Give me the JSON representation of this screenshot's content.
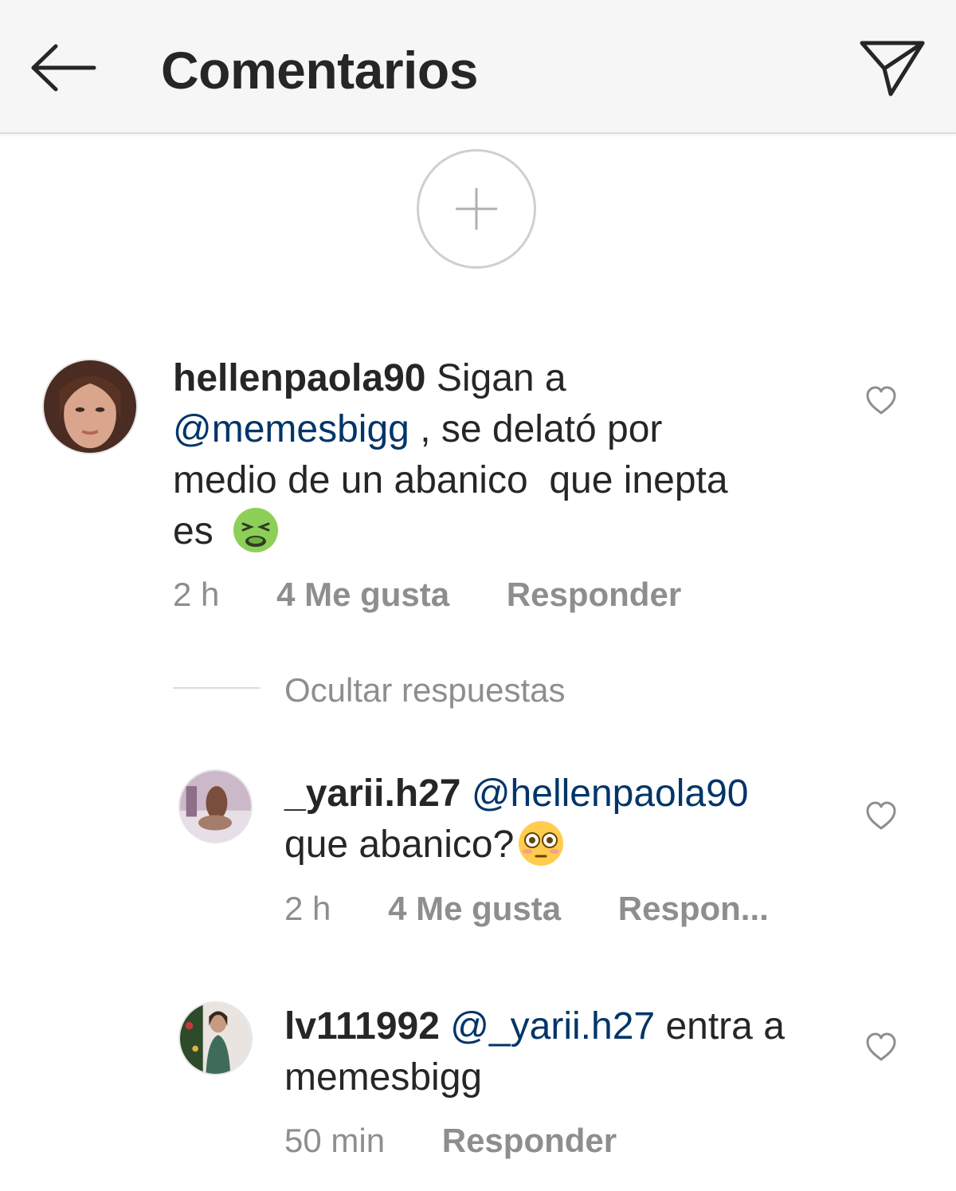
{
  "header": {
    "title": "Comentarios",
    "back_icon": "arrow-left-icon",
    "send_icon": "paper-plane-icon"
  },
  "add_story": {
    "icon": "plus-icon"
  },
  "comments": [
    {
      "username": "hellenpaola90",
      "text_1": "Sigan a",
      "mention": "@memesbigg",
      "text_2": ", se delató por",
      "text_3": "medio de un abanico  que inepta",
      "text_4": "es",
      "emoji": "nauseated-face-emoji",
      "time": "2 h",
      "likes": "4 Me gusta",
      "reply": "Responder"
    }
  ],
  "hide_replies": "Ocultar respuestas",
  "replies": [
    {
      "username": "_yarii.h27",
      "mention": "@hellenpaola90",
      "text": "que abanico?",
      "emoji": "flushed-face-emoji",
      "time": "2 h",
      "likes": "4 Me gusta",
      "reply": "Respon..."
    },
    {
      "username": "lv111992",
      "mention": "@_yarii.h27",
      "text_1": "entra a",
      "text_2": "memesbigg",
      "time": "50 min",
      "reply": "Responder"
    }
  ],
  "colors": {
    "mention": "#003569",
    "meta": "#8e8e8e",
    "text": "#262626"
  }
}
